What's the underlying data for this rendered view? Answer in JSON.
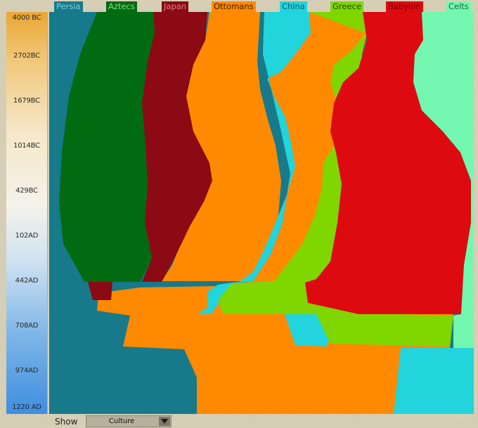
{
  "civs": [
    {
      "name": "Persia",
      "color": "#167a8a",
      "text": "#7fd0dc"
    },
    {
      "name": "Aztecs",
      "color": "#006b10",
      "text": "#7fe07f"
    },
    {
      "name": "Japan",
      "color": "#8b0a14",
      "text": "#e07f86"
    },
    {
      "name": "Ottomans",
      "color": "#ff8a00",
      "text": "#3a2000"
    },
    {
      "name": "China",
      "color": "#22d4dc",
      "text": "#0b5f63"
    },
    {
      "name": "Greece",
      "color": "#80d600",
      "text": "#1f4a00"
    },
    {
      "name": "Babylon",
      "color": "#dd0a10",
      "text": "#7a0006"
    },
    {
      "name": "Celts",
      "color": "#73f7b0",
      "text": "#176b3d"
    }
  ],
  "timeline": [
    "4000 BC",
    "2702BC",
    "1679BC",
    "1014BC",
    "429BC",
    "102AD",
    "442AD",
    "708AD",
    "974AD",
    "1220 AD"
  ],
  "show": {
    "label": "Show",
    "value": "Culture"
  }
}
